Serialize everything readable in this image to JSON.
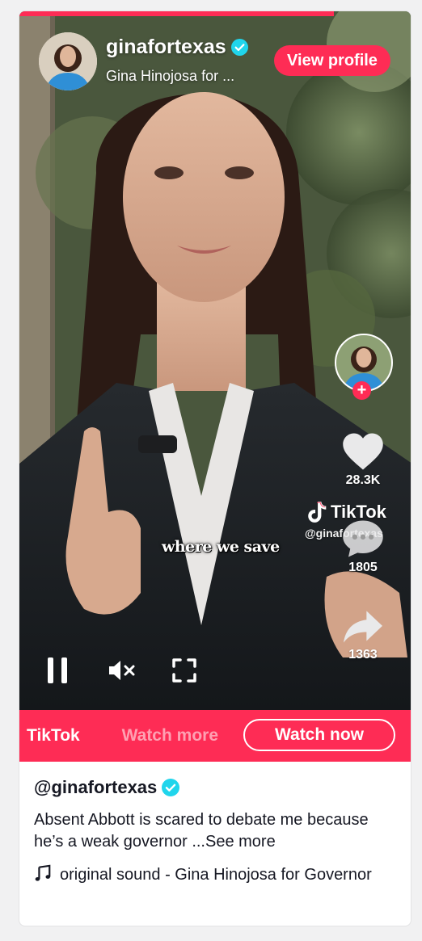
{
  "player": {
    "progress_fraction": 0.8,
    "username": "ginafortexas",
    "display_name": "Gina Hinojosa for ...",
    "view_profile_label": "View profile",
    "caption_text": "where we save",
    "follow_plus": "+",
    "likes_count": "28.3K",
    "comments_count": "1805",
    "shares_count": "1363",
    "watermark_brand": "TikTok",
    "watermark_handle": "@ginafortexas"
  },
  "controls": {
    "play_state_icon": "pause-icon",
    "mute_icon": "muted-speaker-icon",
    "fullscreen_icon": "fullscreen-icon"
  },
  "cta": {
    "marquee_brand": "TikTok",
    "marquee_text": "Watch more",
    "watch_now_label": "Watch now"
  },
  "info": {
    "handle": "@ginafortexas",
    "description": "Absent Abbott is scared to debate me because he’s a weak governor",
    "see_more": "...See more",
    "sound": "original sound - Gina Hinojosa for Governor"
  },
  "colors": {
    "accent": "#fe2c55",
    "verified": "#20d5ec",
    "text": "#161823"
  }
}
